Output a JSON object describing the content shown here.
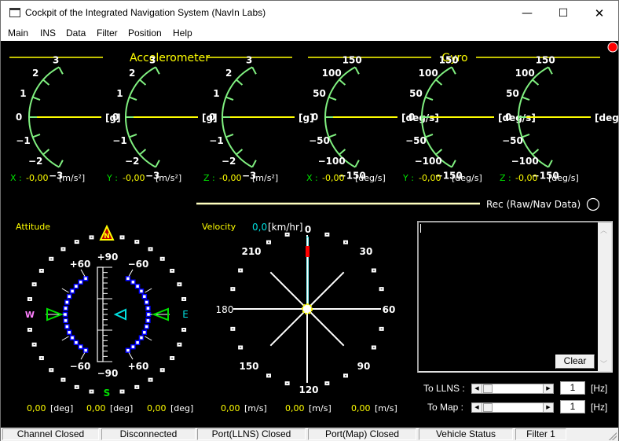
{
  "window": {
    "title": "Cockpit of the Integrated Navigation System (NavIn Labs)",
    "controls": {
      "minimize": "—",
      "maximize": "☐",
      "close": "✕"
    }
  },
  "menu": [
    "Main",
    "INS",
    "Data",
    "Filter",
    "Position",
    "Help"
  ],
  "colors": {
    "background": "#000000",
    "accent_yellow": "#ffff00",
    "gauge_green": "#80f080",
    "cyan": "#00e0e0",
    "indicator_red": "#ff0000",
    "label_green": "#00e000"
  },
  "accelerometer": {
    "title": "Accelerometer",
    "scale_labels": [
      "3",
      "2",
      "1",
      "0",
      "−1",
      "−2",
      "−3"
    ],
    "unit": "[g]",
    "readouts": [
      {
        "axis": "X :",
        "value": "-0,00",
        "unit": "[m/s²]"
      },
      {
        "axis": "Y :",
        "value": "-0,00",
        "unit": "[m/s²]"
      },
      {
        "axis": "Z :",
        "value": "-0,00",
        "unit": "[m/s²]"
      }
    ]
  },
  "gyro": {
    "title": "Gyro",
    "scale_labels": [
      "150",
      "100",
      "50",
      "0",
      "−50",
      "−100",
      "−150"
    ],
    "unit": "[deg/s]",
    "readouts": [
      {
        "axis": "X :",
        "value": "-0,00",
        "unit": "[deg/s]"
      },
      {
        "axis": "Y :",
        "value": "-0,00",
        "unit": "[deg/s]"
      },
      {
        "axis": "Z :",
        "value": "-0,00",
        "unit": "[deg/s]"
      }
    ]
  },
  "recording": {
    "label": "Rec (Raw/Nav Data)",
    "active": false
  },
  "status_led": {
    "state": "error",
    "color": "#ff0000"
  },
  "attitude": {
    "title": "Attitude",
    "compass": {
      "north": "N",
      "south": "S",
      "east": "E",
      "west": "W"
    },
    "pitch_labels": {
      "top": "+90",
      "bottom": "−90"
    },
    "roll_labels": {
      "upper_left": "+60",
      "upper_right": "−60",
      "lower_left": "−60",
      "lower_right": "+60"
    },
    "readouts": [
      {
        "value": "0,00",
        "unit": "[deg]"
      },
      {
        "value": "0,00",
        "unit": "[deg]"
      },
      {
        "value": "0,00",
        "unit": "[deg]"
      }
    ]
  },
  "velocity": {
    "title": "Velocity",
    "speed_value": "0,0",
    "speed_unit": "[km/hr]",
    "dial_labels": [
      "0",
      "30",
      "60",
      "90",
      "120",
      "150",
      "180",
      "210"
    ],
    "readouts": [
      {
        "value": "0,00",
        "unit": "[m/s]"
      },
      {
        "value": "0,00",
        "unit": "[m/s]"
      },
      {
        "value": "0,00",
        "unit": "[m/s]"
      }
    ]
  },
  "log": {
    "content": "",
    "clear_label": "Clear"
  },
  "rates": {
    "llns": {
      "label": "To LLNS :",
      "value": "1",
      "unit": "[Hz]"
    },
    "map": {
      "label": "To Map :",
      "value": "1",
      "unit": "[Hz]"
    }
  },
  "statusbar": [
    "Channel Closed",
    "Disconnected",
    "Port(LLNS) Closed",
    "Port(Map) Closed",
    "Vehicle Status",
    "Filter 1"
  ]
}
